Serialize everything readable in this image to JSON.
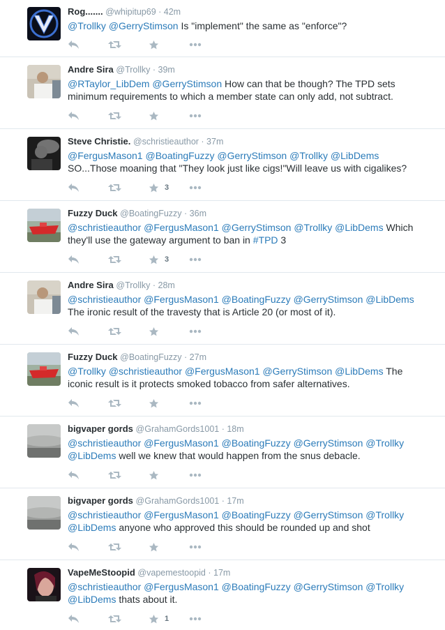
{
  "tweets": [
    {
      "name": "Rog.......",
      "handle": "@whipitup69",
      "time": "42m",
      "avatar": "v-logo-avatar",
      "text_parts": [
        {
          "t": "@Trollky",
          "m": true
        },
        {
          "t": " ",
          "m": false
        },
        {
          "t": "@GerryStimson",
          "m": true
        },
        {
          "t": " Is \"implement\" the same as \"enforce\"?",
          "m": false
        }
      ],
      "fav_count": ""
    },
    {
      "name": "Andre Sira",
      "handle": "@Trollky",
      "time": "39m",
      "avatar": "man-photo-avatar",
      "text_parts": [
        {
          "t": "@RTaylor_LibDem",
          "m": true
        },
        {
          "t": " ",
          "m": false
        },
        {
          "t": "@GerryStimson",
          "m": true
        },
        {
          "t": " How can that be though? The TPD sets minimum requirements to which a member state can only add, not subtract.",
          "m": false
        }
      ],
      "fav_count": ""
    },
    {
      "name": "Steve Christie.",
      "handle": "@schristieauthor",
      "time": "37m",
      "avatar": "vaper-photo-avatar",
      "text_parts": [
        {
          "t": "@FergusMason1",
          "m": true
        },
        {
          "t": " ",
          "m": false
        },
        {
          "t": "@BoatingFuzzy",
          "m": true
        },
        {
          "t": " ",
          "m": false
        },
        {
          "t": "@GerryStimson",
          "m": true
        },
        {
          "t": " ",
          "m": false
        },
        {
          "t": "@Trollky",
          "m": true
        },
        {
          "t": " ",
          "m": false
        },
        {
          "t": "@LibDems",
          "m": true
        },
        {
          "t": " SO...Those moaning that \"They look just like cigs!\"Will leave us with cigalikes?",
          "m": false
        }
      ],
      "fav_count": "3"
    },
    {
      "name": "Fuzzy Duck",
      "handle": "@BoatingFuzzy",
      "time": "36m",
      "avatar": "red-boat-avatar",
      "text_parts": [
        {
          "t": "@schristieauthor",
          "m": true
        },
        {
          "t": " ",
          "m": false
        },
        {
          "t": "@FergusMason1",
          "m": true
        },
        {
          "t": " ",
          "m": false
        },
        {
          "t": "@GerryStimson",
          "m": true
        },
        {
          "t": " ",
          "m": false
        },
        {
          "t": "@Trollky",
          "m": true
        },
        {
          "t": " ",
          "m": false
        },
        {
          "t": "@LibDems",
          "m": true
        },
        {
          "t": " Which they'll use the gateway argument to ban in ",
          "m": false
        },
        {
          "t": "#TPD",
          "m": true
        },
        {
          "t": " 3",
          "m": false
        }
      ],
      "fav_count": "3"
    },
    {
      "name": "Andre Sira",
      "handle": "@Trollky",
      "time": "28m",
      "avatar": "man-photo-avatar",
      "text_parts": [
        {
          "t": "@schristieauthor",
          "m": true
        },
        {
          "t": " ",
          "m": false
        },
        {
          "t": "@FergusMason1",
          "m": true
        },
        {
          "t": " ",
          "m": false
        },
        {
          "t": "@BoatingFuzzy",
          "m": true
        },
        {
          "t": " ",
          "m": false
        },
        {
          "t": "@GerryStimson",
          "m": true
        },
        {
          "t": " ",
          "m": false
        },
        {
          "t": "@LibDems",
          "m": true
        },
        {
          "t": " The ironic result of the travesty that is Article 20 (or most of it).",
          "m": false
        }
      ],
      "fav_count": ""
    },
    {
      "name": "Fuzzy Duck",
      "handle": "@BoatingFuzzy",
      "time": "27m",
      "avatar": "red-boat-avatar",
      "text_parts": [
        {
          "t": "@Trollky",
          "m": true
        },
        {
          "t": " ",
          "m": false
        },
        {
          "t": "@schristieauthor",
          "m": true
        },
        {
          "t": " ",
          "m": false
        },
        {
          "t": "@FergusMason1",
          "m": true
        },
        {
          "t": " ",
          "m": false
        },
        {
          "t": "@GerryStimson",
          "m": true
        },
        {
          "t": " ",
          "m": false
        },
        {
          "t": "@LibDems",
          "m": true
        },
        {
          "t": " The iconic result is it protects smoked tobacco from safer alternatives.",
          "m": false
        }
      ],
      "fav_count": ""
    },
    {
      "name": "bigvaper gords",
      "handle": "@GrahamGords1001",
      "time": "18m",
      "avatar": "fog-photo-avatar",
      "text_parts": [
        {
          "t": "@schristieauthor",
          "m": true
        },
        {
          "t": " ",
          "m": false
        },
        {
          "t": "@FergusMason1",
          "m": true
        },
        {
          "t": " ",
          "m": false
        },
        {
          "t": "@BoatingFuzzy",
          "m": true
        },
        {
          "t": " ",
          "m": false
        },
        {
          "t": "@GerryStimson",
          "m": true
        },
        {
          "t": " ",
          "m": false
        },
        {
          "t": "@Trollky",
          "m": true
        },
        {
          "t": " ",
          "m": false
        },
        {
          "t": "@LibDems",
          "m": true
        },
        {
          "t": " well we knew that would happen from the snus debacle.",
          "m": false
        }
      ],
      "fav_count": ""
    },
    {
      "name": "bigvaper gords",
      "handle": "@GrahamGords1001",
      "time": "17m",
      "avatar": "fog-photo-avatar",
      "text_parts": [
        {
          "t": "@schristieauthor",
          "m": true
        },
        {
          "t": " ",
          "m": false
        },
        {
          "t": "@FergusMason1",
          "m": true
        },
        {
          "t": " ",
          "m": false
        },
        {
          "t": "@BoatingFuzzy",
          "m": true
        },
        {
          "t": " ",
          "m": false
        },
        {
          "t": "@GerryStimson",
          "m": true
        },
        {
          "t": " ",
          "m": false
        },
        {
          "t": "@Trollky",
          "m": true
        },
        {
          "t": " ",
          "m": false
        },
        {
          "t": "@LibDems",
          "m": true
        },
        {
          "t": " anyone who approved this should be rounded up and shot",
          "m": false
        }
      ],
      "fav_count": ""
    },
    {
      "name": "VapeMeStoopid",
      "handle": "@vapemestoopid",
      "time": "17m",
      "avatar": "woman-photo-avatar",
      "text_parts": [
        {
          "t": "@schristieauthor",
          "m": true
        },
        {
          "t": " ",
          "m": false
        },
        {
          "t": "@FergusMason1",
          "m": true
        },
        {
          "t": " ",
          "m": false
        },
        {
          "t": "@BoatingFuzzy",
          "m": true
        },
        {
          "t": " ",
          "m": false
        },
        {
          "t": "@GerryStimson",
          "m": true
        },
        {
          "t": " ",
          "m": false
        },
        {
          "t": "@Trollky",
          "m": true
        },
        {
          "t": " ",
          "m": false
        },
        {
          "t": "@LibDems",
          "m": true
        },
        {
          "t": " thats about it.",
          "m": false
        }
      ],
      "fav_count": "1"
    }
  ],
  "colors": {
    "link": "#2b7bb9",
    "meta": "#8899a6",
    "icon": "#aab8c2",
    "divider": "#e1e8ed"
  }
}
